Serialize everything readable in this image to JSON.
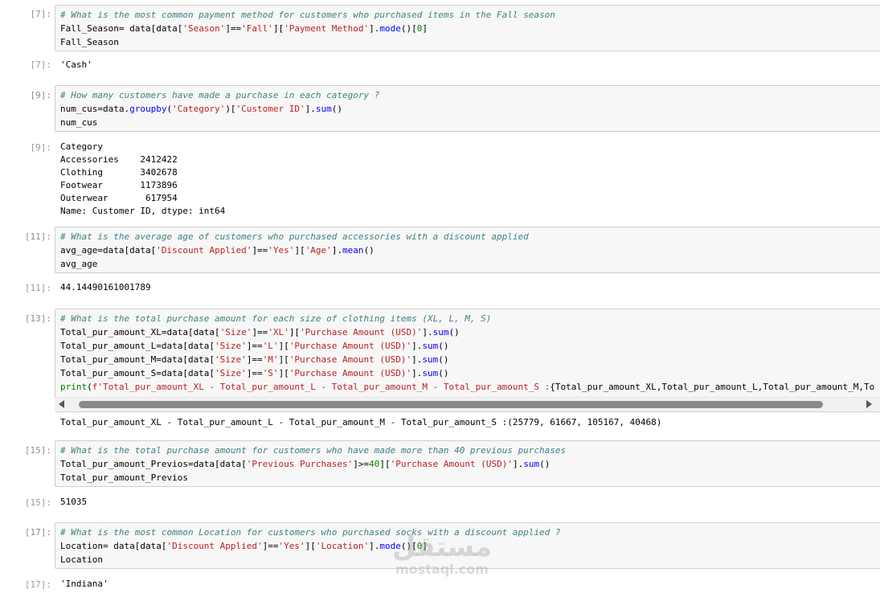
{
  "cells": [
    {
      "in_prompt": "[7]:",
      "lines": [
        [
          {
            "t": "# What is the most common payment method for customers who purchased items in the Fall season",
            "c": "cm"
          }
        ],
        [
          {
            "t": "Fall_Season= data[data["
          },
          {
            "t": "'Season'",
            "c": "st"
          },
          {
            "t": "]=="
          },
          {
            "t": "'Fall'",
            "c": "st"
          },
          {
            "t": "]["
          },
          {
            "t": "'Payment Method'",
            "c": "st"
          },
          {
            "t": "]."
          },
          {
            "t": "mode",
            "c": "fn"
          },
          {
            "t": "()["
          },
          {
            "t": "0",
            "c": "nm"
          },
          {
            "t": "]"
          }
        ],
        [
          {
            "t": "Fall_Season"
          }
        ]
      ],
      "out_prompt": "[7]:",
      "output": "'Cash'"
    },
    {
      "in_prompt": "[9]:",
      "lines": [
        [
          {
            "t": "# How many customers have made a purchase in each category ?",
            "c": "cm"
          }
        ],
        [
          {
            "t": "num_cus=data."
          },
          {
            "t": "groupby",
            "c": "fn"
          },
          {
            "t": "("
          },
          {
            "t": "'Category'",
            "c": "st"
          },
          {
            "t": ")["
          },
          {
            "t": "'Customer ID'",
            "c": "st"
          },
          {
            "t": "]."
          },
          {
            "t": "sum",
            "c": "fn"
          },
          {
            "t": "()"
          }
        ],
        [
          {
            "t": "num_cus"
          }
        ]
      ],
      "out_prompt": "[9]:",
      "output": "Category\nAccessories    2412422\nClothing       3402678\nFootwear       1173896\nOuterwear       617954\nName: Customer ID, dtype: int64"
    },
    {
      "in_prompt": "[11]:",
      "lines": [
        [
          {
            "t": "# What is the average age of customers who purchased accessories with a discount applied",
            "c": "cm"
          }
        ],
        [
          {
            "t": "avg_age=data[data["
          },
          {
            "t": "'Discount Applied'",
            "c": "st"
          },
          {
            "t": "]=="
          },
          {
            "t": "'Yes'",
            "c": "st"
          },
          {
            "t": "]["
          },
          {
            "t": "'Age'",
            "c": "st"
          },
          {
            "t": "]."
          },
          {
            "t": "mean",
            "c": "fn"
          },
          {
            "t": "()"
          }
        ],
        [
          {
            "t": "avg_age"
          }
        ]
      ],
      "out_prompt": "[11]:",
      "output": "44.14490161001789"
    },
    {
      "in_prompt": "[13]:",
      "lines": [
        [
          {
            "t": "# What is the total purchase amount for each size of clothing items (XL, L, M, S)",
            "c": "cm"
          }
        ],
        [
          {
            "t": "Total_pur_amount_XL=data[data["
          },
          {
            "t": "'Size'",
            "c": "st"
          },
          {
            "t": "]=="
          },
          {
            "t": "'XL'",
            "c": "st"
          },
          {
            "t": "]["
          },
          {
            "t": "'Purchase Amount (USD)'",
            "c": "st"
          },
          {
            "t": "]."
          },
          {
            "t": "sum",
            "c": "fn"
          },
          {
            "t": "()"
          }
        ],
        [
          {
            "t": "Total_pur_amount_L=data[data["
          },
          {
            "t": "'Size'",
            "c": "st"
          },
          {
            "t": "]=="
          },
          {
            "t": "'L'",
            "c": "st"
          },
          {
            "t": "]["
          },
          {
            "t": "'Purchase Amount (USD)'",
            "c": "st"
          },
          {
            "t": "]."
          },
          {
            "t": "sum",
            "c": "fn"
          },
          {
            "t": "()"
          }
        ],
        [
          {
            "t": "Total_pur_amount_M=data[data["
          },
          {
            "t": "'Size'",
            "c": "st"
          },
          {
            "t": "]=="
          },
          {
            "t": "'M'",
            "c": "st"
          },
          {
            "t": "]["
          },
          {
            "t": "'Purchase Amount (USD)'",
            "c": "st"
          },
          {
            "t": "]."
          },
          {
            "t": "sum",
            "c": "fn"
          },
          {
            "t": "()"
          }
        ],
        [
          {
            "t": "Total_pur_amount_S=data[data["
          },
          {
            "t": "'Size'",
            "c": "st"
          },
          {
            "t": "]=="
          },
          {
            "t": "'S'",
            "c": "st"
          },
          {
            "t": "]["
          },
          {
            "t": "'Purchase Amount (USD)'",
            "c": "st"
          },
          {
            "t": "]."
          },
          {
            "t": "sum",
            "c": "fn"
          },
          {
            "t": "()"
          }
        ],
        [
          {
            "t": "print",
            "c": "kw"
          },
          {
            "t": "("
          },
          {
            "t": "f'Total_pur_amount_XL - Total_pur_amount_L - Total_pur_amount_M - Total_pur_amount_S :",
            "c": "st"
          },
          {
            "t": "{Total_pur_amount_XL,Total_pur_amount_L,Total_pur_amount_M,To"
          }
        ]
      ],
      "out_prompt": "",
      "output": "Total_pur_amount_XL - Total_pur_amount_L - Total_pur_amount_M - Total_pur_amount_S :(25779, 61667, 105167, 40468)"
    },
    {
      "in_prompt": "[15]:",
      "lines": [
        [
          {
            "t": "# What is the total purchase amount for customers who have made more than 40 previous purchases",
            "c": "cm"
          }
        ],
        [
          {
            "t": "Total_pur_amount_Previos=data[data["
          },
          {
            "t": "'Previous Purchases'",
            "c": "st"
          },
          {
            "t": "]>="
          },
          {
            "t": "40",
            "c": "nm"
          },
          {
            "t": "]["
          },
          {
            "t": "'Purchase Amount (USD)'",
            "c": "st"
          },
          {
            "t": "]."
          },
          {
            "t": "sum",
            "c": "fn"
          },
          {
            "t": "()"
          }
        ],
        [
          {
            "t": "Total_pur_amount_Previos"
          }
        ]
      ],
      "out_prompt": "[15]:",
      "output": "51035"
    },
    {
      "in_prompt": "[17]:",
      "lines": [
        [
          {
            "t": "# What is the most common Location for customers who purchased socks with a discount applied ?",
            "c": "cm"
          }
        ],
        [
          {
            "t": "Location= data[data["
          },
          {
            "t": "'Discount Applied'",
            "c": "st"
          },
          {
            "t": "]=="
          },
          {
            "t": "'Yes'",
            "c": "st"
          },
          {
            "t": "]["
          },
          {
            "t": "'Location'",
            "c": "st"
          },
          {
            "t": "]."
          },
          {
            "t": "mode",
            "c": "fn"
          },
          {
            "t": "()["
          },
          {
            "t": "0",
            "c": "nm"
          },
          {
            "t": "]"
          }
        ],
        [
          {
            "t": "Location"
          }
        ]
      ],
      "out_prompt": "[17]:",
      "output": "'Indiana'"
    }
  ],
  "watermark": {
    "logo": "مستقل",
    "text": "mostaql.com"
  }
}
